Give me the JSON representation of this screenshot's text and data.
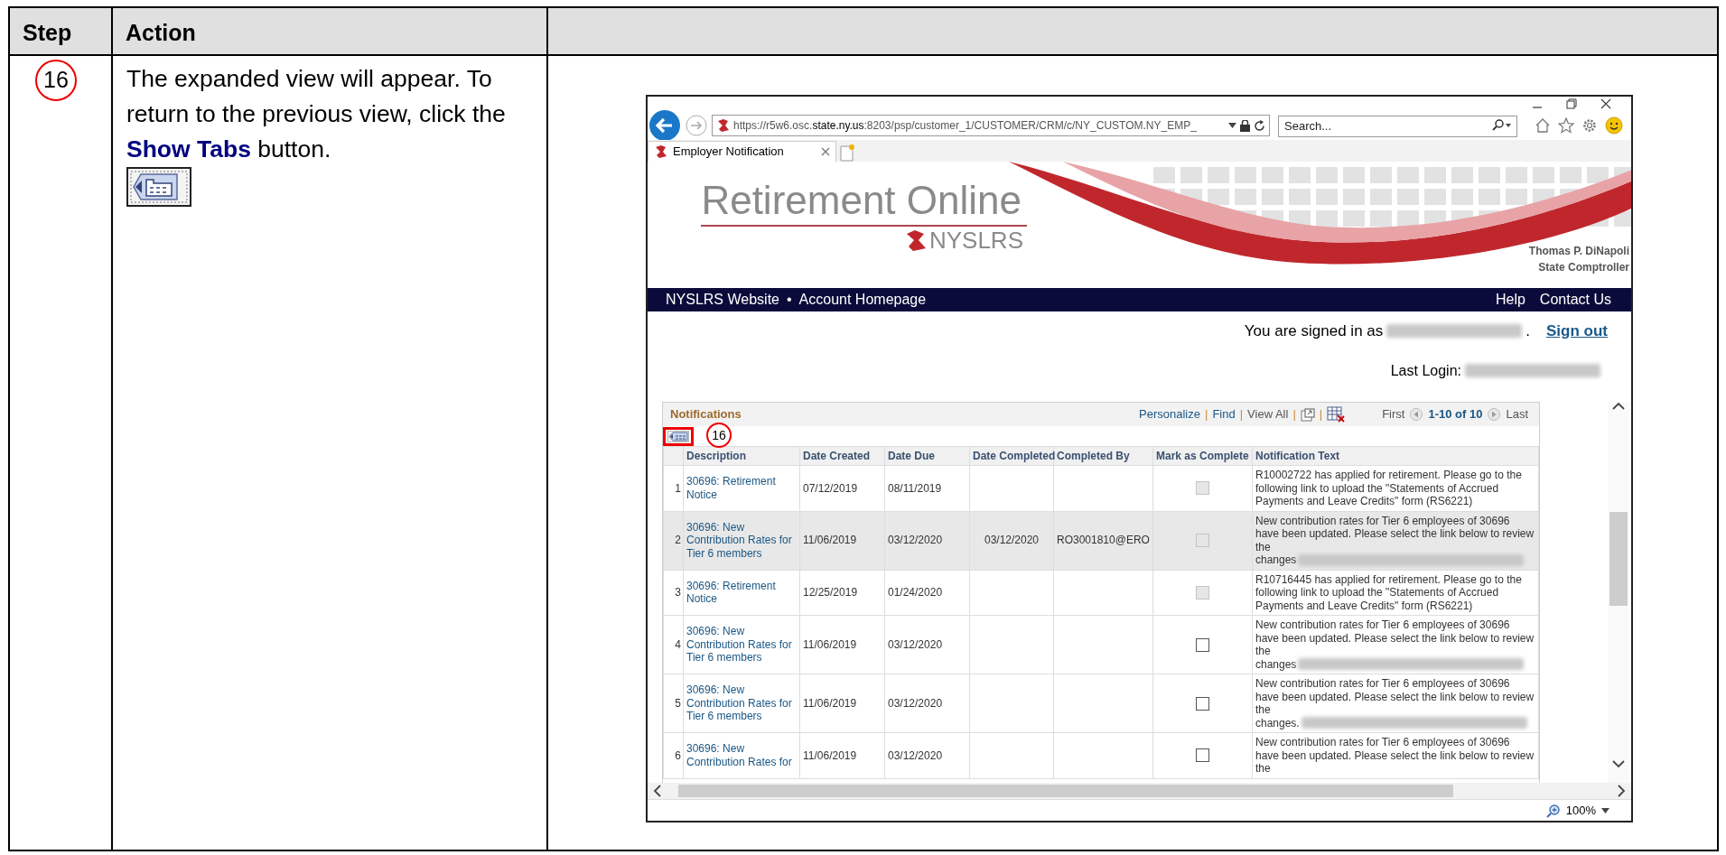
{
  "doc": {
    "columns": [
      "Step",
      "Action"
    ],
    "step": "16",
    "instruction": "The expanded view will appear. To return to the previous view, click the **Show Tabs** button."
  },
  "browser": {
    "url": "https://r5w6.osc.**state.ny.us**:8203/psp/customer_1/CUSTOMER/CRM/c/NY_CUSTOM.NY_EMP_",
    "search_placeholder": "Search...",
    "tab": "Employer Notification",
    "zoom": "100%"
  },
  "site": {
    "title": "Retirement Online",
    "logo": "NYSLRS",
    "official_name": "Thomas P. DiNapoli",
    "official_title": "State Comptroller",
    "nav_left": [
      "NYSLRS Website",
      "Account Homepage"
    ],
    "nav_separator": "•",
    "nav_right": [
      "Help",
      "Contact Us"
    ],
    "signed_in": "You are signed in as",
    "signed_in_end": ".",
    "sign_out": "Sign out",
    "last_login": "Last Login:"
  },
  "grid": {
    "title": "Notifications",
    "toolbar": [
      "Personalize",
      "Find",
      "View All"
    ],
    "separator": "|",
    "pager": {
      "first": "First",
      "range": "1-10 of 10",
      "last": "Last"
    },
    "callout": "16",
    "columns": [
      "Description",
      "Date Created",
      "Date Due",
      "Date Completed",
      "Completed By",
      "Mark as Complete",
      "Notification Text"
    ],
    "rows": [
      {
        "number": "1",
        "description": "30696: Retirement Notice",
        "date_created": "07/12/2019",
        "date_due": "08/11/2019",
        "highlighted": false,
        "mark_complete": {
          "disabled": true,
          "checked": false
        },
        "notification_text": "R10002722 has applied for retirement.  Please go to the following link to upload the \"Statements of Accrued Payments and Leave Credits\" form (RS6221)"
      },
      {
        "number": "2",
        "description": "30696: New Contribution Rates for Tier 6 members",
        "date_created": "11/06/2019",
        "date_due": "03/12/2020",
        "date_completed": "03/12/2020",
        "completed_by": "RO3001810@ERO",
        "highlighted": true,
        "mark_complete": {
          "disabled": true,
          "checked": false
        },
        "notification_text": "New contribution rates for Tier 6 employees of 30696 have been updated. Please select the link below to review the",
        "link_text": "changes",
        "redacted": true
      },
      {
        "number": "3",
        "description": "30696: Retirement Notice",
        "date_created": "12/25/2019",
        "date_due": "01/24/2020",
        "highlighted": false,
        "mark_complete": {
          "disabled": true,
          "checked": false
        },
        "notification_text": "R10716445 has applied for retirement.  Please go to the following link to upload the \"Statements of Accrued Payments and Leave Credits\" form (RS6221)"
      },
      {
        "number": "4",
        "description": "30696: New Contribution Rates for Tier 6 members",
        "date_created": "11/06/2019",
        "date_due": "03/12/2020",
        "highlighted": false,
        "mark_complete": {
          "disabled": false,
          "checked": false
        },
        "notification_text": "New contribution rates for Tier 6 employees of 30696 have been updated. Please select the link below to review the",
        "link_text": "changes",
        "redacted": true
      },
      {
        "number": "5",
        "description": "30696: New Contribution Rates for Tier 6 members",
        "date_created": "11/06/2019",
        "date_due": "03/12/2020",
        "highlighted": false,
        "mark_complete": {
          "disabled": false,
          "checked": false
        },
        "notification_text": "New contribution rates for Tier 6 employees of 30696 have been updated. Please select the link below to review the",
        "link_text": "changes.",
        "redacted": true
      },
      {
        "number": "6",
        "description": "30696: New Contribution Rates for",
        "date_created": "11/06/2019",
        "date_due": "03/12/2020",
        "highlighted": false,
        "mark_complete": {
          "disabled": false,
          "checked": false
        },
        "notification_text": "New contribution rates for Tier 6 employees of 30696 have been updated. Please select the link below to review the"
      }
    ]
  }
}
